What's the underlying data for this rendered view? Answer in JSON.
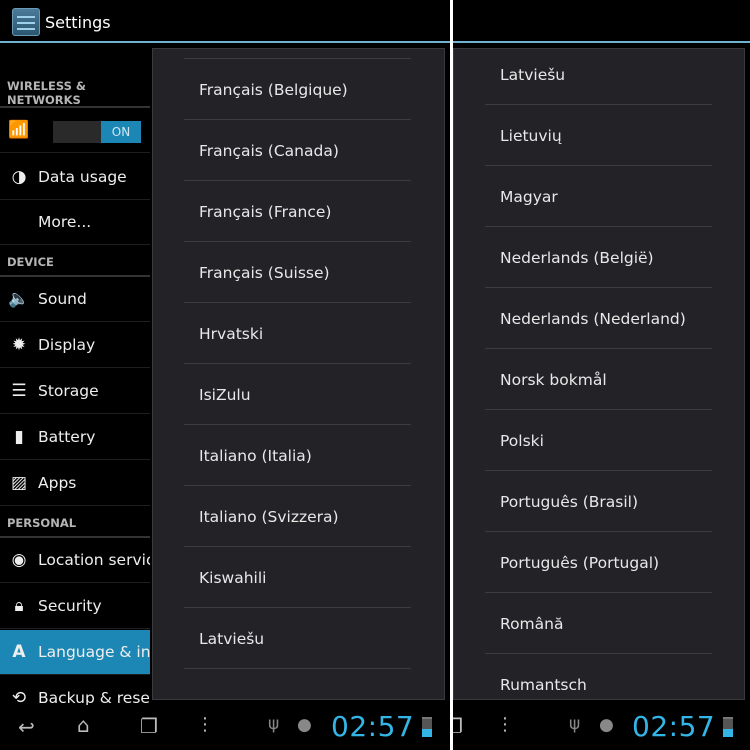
{
  "left": {
    "title": "Settings",
    "sidebar": {
      "sections": [
        "WIRELESS & NETWORKS",
        "DEVICE",
        "PERSONAL"
      ],
      "wifi_toggle": "ON",
      "items": [
        {
          "label": "Data usage",
          "icon": "data-usage-icon"
        },
        {
          "label": "More...",
          "icon": ""
        },
        {
          "label": "Sound",
          "icon": "speaker-icon"
        },
        {
          "label": "Display",
          "icon": "brightness-icon"
        },
        {
          "label": "Storage",
          "icon": "storage-icon"
        },
        {
          "label": "Battery",
          "icon": "battery-icon"
        },
        {
          "label": "Apps",
          "icon": "apps-icon"
        },
        {
          "label": "Location services",
          "icon": "location-icon"
        },
        {
          "label": "Security",
          "icon": "lock-icon"
        },
        {
          "label": "Language & input",
          "icon": "language-icon",
          "selected": true
        },
        {
          "label": "Backup & reset",
          "icon": "backup-icon"
        }
      ]
    },
    "languages": [
      "Français (Belgique)",
      "Français (Canada)",
      "Français (France)",
      "Français (Suisse)",
      "Hrvatski",
      "IsiZulu",
      "Italiano (Italia)",
      "Italiano (Svizzera)",
      "Kiswahili",
      "Latviešu"
    ],
    "time": "02:57"
  },
  "right": {
    "languages": [
      "Latviešu",
      "Lietuvių",
      "Magyar",
      "Nederlands (België)",
      "Nederlands (Nederland)",
      "Norsk bokmål",
      "Polski",
      "Português (Brasil)",
      "Português (Portugal)",
      "Română",
      "Rumantsch"
    ],
    "time": "02:57"
  },
  "colors": {
    "accent": "#33b5e5",
    "selected": "#1c87b4",
    "dialog": "#232327"
  }
}
